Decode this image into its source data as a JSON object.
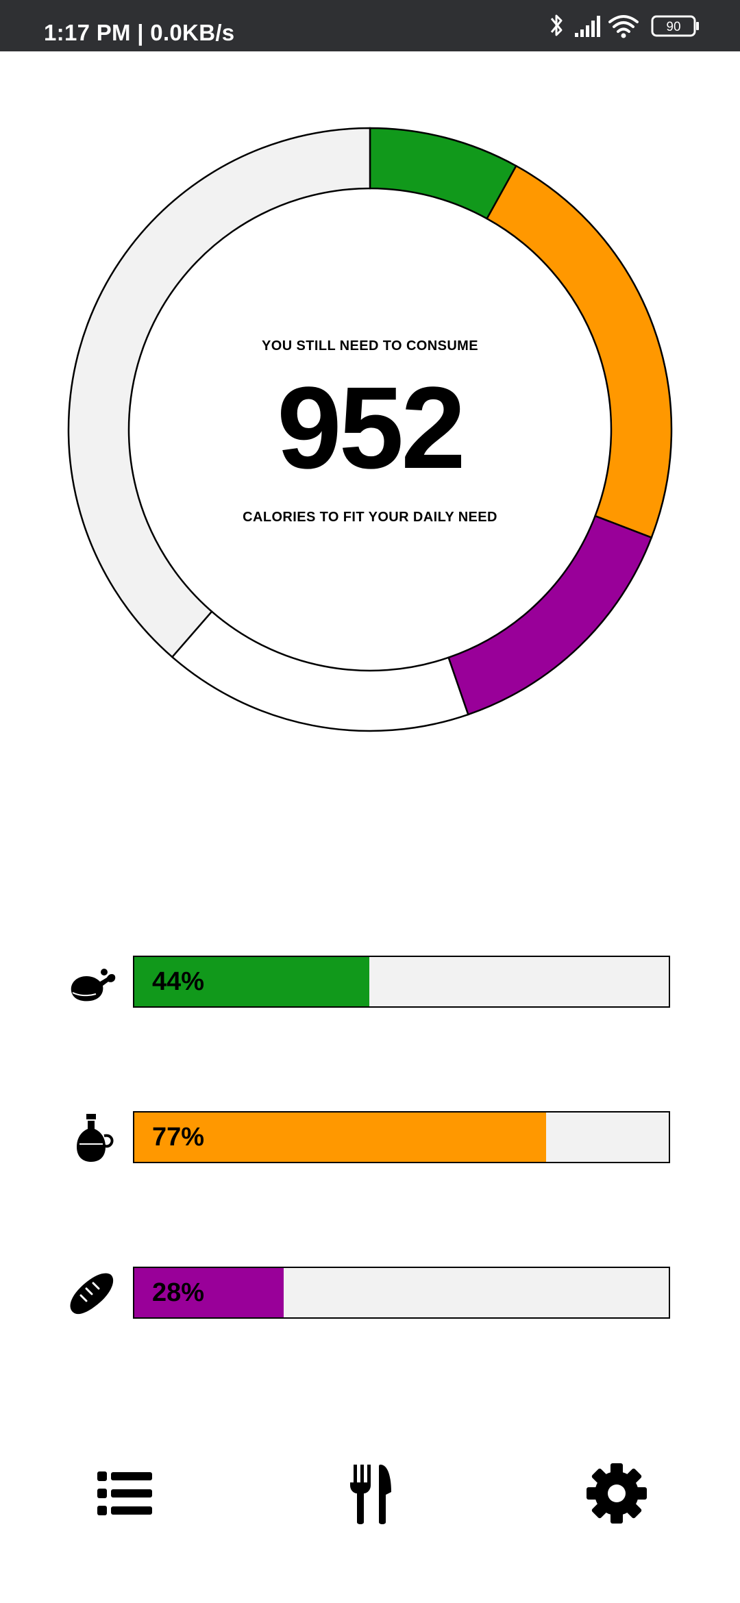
{
  "status_bar": {
    "time": "1:17 PM | 0.0KB/s",
    "battery": "90",
    "icons": [
      "bluetooth-icon",
      "signal-icon",
      "wifi-icon",
      "battery-icon"
    ]
  },
  "summary": {
    "top_text": "YOU STILL NEED TO CONSUME",
    "calories": "952",
    "bottom_text": "CALORIES TO FIT YOUR DAILY NEED"
  },
  "ring": {
    "segments": [
      {
        "name": "protein",
        "start_deg": 0,
        "end_deg": 29,
        "color": "#11991b"
      },
      {
        "name": "fat",
        "start_deg": 29,
        "end_deg": 111,
        "color": "#ff9800"
      },
      {
        "name": "carbs",
        "start_deg": 111,
        "end_deg": 161,
        "color": "#990099"
      },
      {
        "name": "remaining-white",
        "start_deg": 161,
        "end_deg": 221,
        "color": "#ffffff"
      },
      {
        "name": "remaining-gray",
        "start_deg": 221,
        "end_deg": 360,
        "color": "#f2f2f2"
      }
    ]
  },
  "macros": [
    {
      "icon": "chicken-leg-icon",
      "label": "44%",
      "value": 0.44,
      "color": "#11991b"
    },
    {
      "icon": "oil-bottle-icon",
      "label": "77%",
      "value": 0.77,
      "color": "#ff9800"
    },
    {
      "icon": "bread-icon",
      "label": "28%",
      "value": 0.28,
      "color": "#990099"
    }
  ],
  "nav": {
    "items": [
      "list-icon",
      "utensils-icon",
      "settings-gear-icon"
    ]
  }
}
